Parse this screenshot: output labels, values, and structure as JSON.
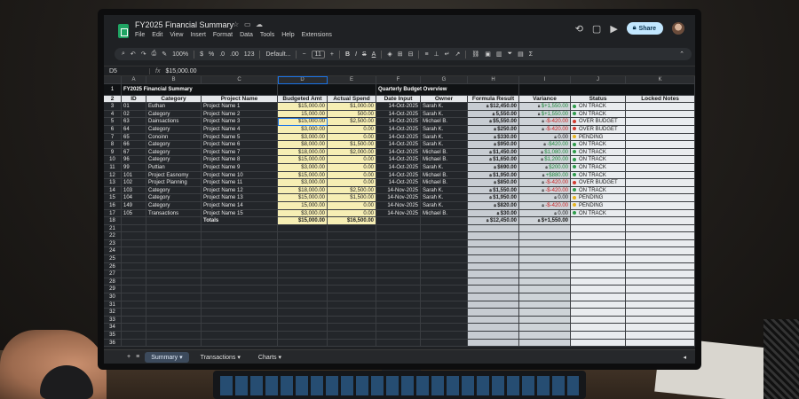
{
  "app": {
    "title": "FY2025 Financial Summary",
    "menu": [
      "File",
      "Edit",
      "View",
      "Insert",
      "Format",
      "Data",
      "Tools",
      "Help",
      "Extensions"
    ],
    "share_label": "Share"
  },
  "toolbar": {
    "zoom": "100%",
    "currency": "$",
    "percent": "%",
    "dec_less": ".0",
    "dec_more": ".00",
    "number_format": "123",
    "font": "Default...",
    "font_size": "11"
  },
  "formula_bar": {
    "cell_ref": "D5",
    "fx": "fx",
    "value": "$15,000.00"
  },
  "columns": [
    "A",
    "B",
    "C",
    "D",
    "E",
    "F",
    "G",
    "H",
    "I",
    "J",
    "K"
  ],
  "sheet": {
    "title": "FY2025 Financial Summary",
    "subtitle": "Quarterly Budget Overview",
    "headers": [
      "ID",
      "Category",
      "Project Name",
      "Budgeted Amt",
      "Actual Spend",
      "Date Input",
      "Owner",
      "Formula Result",
      "Variance",
      "Status",
      "Locked Notes"
    ],
    "rows": [
      {
        "id": "01",
        "cat": "Euthan",
        "name": "Project Name 1",
        "budget": "$15,000.00",
        "actual": "$1,000.00",
        "date": "14-Oct-2025",
        "owner": "Sarah K.",
        "formula": "$12,450.00",
        "var": "$+1,550.00",
        "var_color": "green",
        "status": "ON TRACK",
        "status_color": "#2e9b4a"
      },
      {
        "id": "02",
        "cat": "Category",
        "name": "Project Name 2",
        "budget": "15,000.00",
        "actual": "500.00",
        "date": "14-Oct-2025",
        "owner": "Sarah K.",
        "formula": "5,550.00",
        "var": "$+1,550.00",
        "var_color": "green",
        "status": "ON TRACK",
        "status_color": "#2e9b4a"
      },
      {
        "id": "63",
        "cat": "Dainsactions",
        "name": "Project Name 3",
        "budget": "$15,000.00",
        "actual": "$2,500.00",
        "date": "14-Oct-2025",
        "owner": "Michael B.",
        "formula": "$5,550.00",
        "var": "-$-420.00",
        "var_color": "red",
        "status": "OVER BUDGET",
        "status_color": "#d23a2f"
      },
      {
        "id": "64",
        "cat": "Category",
        "name": "Project Name 4",
        "budget": "$3,000.00",
        "actual": "0.00",
        "date": "14-Oct-2025",
        "owner": "Sarah K.",
        "formula": "$250.00",
        "var": "-$-420.00",
        "var_color": "red",
        "status": "OVER BUDGET",
        "status_color": "#d23a2f"
      },
      {
        "id": "65",
        "cat": "Conoinn",
        "name": "Project Name 5",
        "budget": "$3,000.00",
        "actual": "0.00",
        "date": "14-Oct-2025",
        "owner": "Sarah K.",
        "formula": "$330.00",
        "var": "0.00",
        "var_color": "plain",
        "status": "PENDING",
        "status_color": "#e6b422"
      },
      {
        "id": "66",
        "cat": "Category",
        "name": "Project Name 6",
        "budget": "$8,000.00",
        "actual": "$1,500.00",
        "date": "14-Oct-2025",
        "owner": "Sarah K.",
        "formula": "$950.00",
        "var": "-$420.00",
        "var_color": "green",
        "status": "ON TRACK",
        "status_color": "#2e9b4a"
      },
      {
        "id": "67",
        "cat": "Category",
        "name": "Project Name 7",
        "budget": "$18,000.00",
        "actual": "$2,000.00",
        "date": "14-Oct-2025",
        "owner": "Michael B.",
        "formula": "$1,450.00",
        "var": "$1,080.00",
        "var_color": "green",
        "status": "ON TRACK",
        "status_color": "#2e9b4a"
      },
      {
        "id": "96",
        "cat": "Category",
        "name": "Project Name 8",
        "budget": "$15,000.00",
        "actual": "0.00",
        "date": "14-Oct-2025",
        "owner": "Michael B.",
        "formula": "$1,650.00",
        "var": "$1,200.00",
        "var_color": "green",
        "status": "ON TRACK",
        "status_color": "#2e9b4a"
      },
      {
        "id": "99",
        "cat": "Puttian",
        "name": "Project Name 9",
        "budget": "$3,000.00",
        "actual": "0.00",
        "date": "14-Oct-2025",
        "owner": "Sarah K.",
        "formula": "$690.00",
        "var": "$200.00",
        "var_color": "green",
        "status": "ON TRACK",
        "status_color": "#2e9b4a"
      },
      {
        "id": "101",
        "cat": "Project Easnomy",
        "name": "Project Name 10",
        "budget": "$15,000.00",
        "actual": "0.00",
        "date": "14-Oct-2025",
        "owner": "Michael B.",
        "formula": "$1,950.00",
        "var": "+$880.00",
        "var_color": "green",
        "status": "ON TRACK",
        "status_color": "#2e9b4a"
      },
      {
        "id": "102",
        "cat": "Project Planning",
        "name": "Project Name 11",
        "budget": "$3,000.00",
        "actual": "0.00",
        "date": "14-Oct-2025",
        "owner": "Michael B.",
        "formula": "$850.00",
        "var": "-$-420.00",
        "var_color": "red",
        "status": "OVER BUDGET",
        "status_color": "#d23a2f"
      },
      {
        "id": "103",
        "cat": "Category",
        "name": "Project Name 12",
        "budget": "$18,000.00",
        "actual": "$2,500.00",
        "date": "14-Nov-2025",
        "owner": "Sarah K.",
        "formula": "$1,550.00",
        "var": "-$-420.00",
        "var_color": "red",
        "status": "ON TRACK",
        "status_color": "#2e9b4a"
      },
      {
        "id": "104",
        "cat": "Category",
        "name": "Project Name 13",
        "budget": "$15,000.00",
        "actual": "$1,500.00",
        "date": "14-Nov-2025",
        "owner": "Sarah K.",
        "formula": "$1,950.00",
        "var": "0.00",
        "var_color": "plain",
        "status": "PENDING",
        "status_color": "#e6b422"
      },
      {
        "id": "149",
        "cat": "Category",
        "name": "Project Name 14",
        "budget": "15,000.00",
        "actual": "0.00",
        "date": "14-Nov-2025",
        "owner": "Sarah K.",
        "formula": "$820.00",
        "var": "-$-420.00",
        "var_color": "red",
        "status": "PENDING",
        "status_color": "#e6b422"
      },
      {
        "id": "105",
        "cat": "Transactions",
        "name": "Project Name 15",
        "budget": "$3,000.00",
        "actual": "0.00",
        "date": "14-Nov-2025",
        "owner": "Michael B.",
        "formula": "$30.00",
        "var": "0.00",
        "var_color": "plain",
        "status": "ON TRACK",
        "status_color": "#2e9b4a"
      }
    ],
    "totals": {
      "label": "Totals",
      "budget": "$15,000.00",
      "actual": "$16,500.00",
      "formula": "$12,450.00",
      "var": "$+1,550.00"
    },
    "empty_row_start": 21,
    "empty_row_end": 36
  },
  "sheet_tabs": [
    "Summary",
    "Transactions",
    "Charts"
  ],
  "colors": {
    "accent": "#1a73e8",
    "brand": "#1fa463",
    "on_track": "#2e9b4a",
    "over_budget": "#d23a2f",
    "pending": "#e6b422"
  }
}
